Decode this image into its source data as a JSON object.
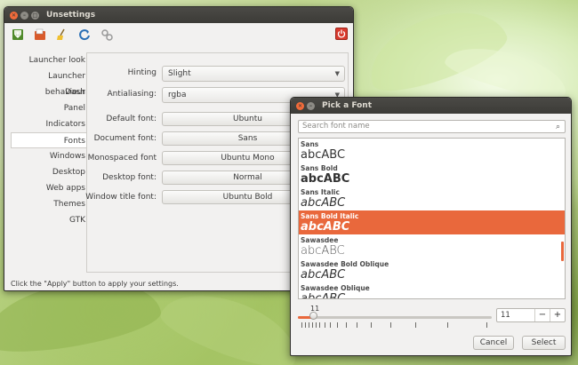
{
  "main_window": {
    "title": "Unsettings",
    "toolbar": {
      "icons": [
        "save-icon",
        "open-icon",
        "clean-icon",
        "refresh-icon",
        "settings-icon"
      ],
      "power_icon": "power-icon"
    },
    "sidebar": {
      "items": [
        {
          "label": "Launcher look"
        },
        {
          "label": "Launcher behaviour"
        },
        {
          "label": "Dash"
        },
        {
          "label": "Panel"
        },
        {
          "label": "Indicators"
        },
        {
          "label": "Fonts",
          "selected": true
        },
        {
          "label": "Windows"
        },
        {
          "label": "Desktop"
        },
        {
          "label": "Web apps"
        },
        {
          "label": "Themes"
        },
        {
          "label": "GTK"
        }
      ]
    },
    "fonts_panel": {
      "hinting": {
        "label": "Hinting",
        "value": "Slight"
      },
      "antialiasing": {
        "label": "Antialiasing:",
        "value": "rgba"
      },
      "default_font": {
        "label": "Default font:",
        "value": "Ubuntu"
      },
      "document_font": {
        "label": "Document font:",
        "value": "Sans"
      },
      "monospaced_font": {
        "label": "Monospaced font",
        "value": "Ubuntu Mono"
      },
      "desktop_font": {
        "label": "Desktop font:",
        "value": "Normal"
      },
      "window_title_font": {
        "label": "Window title font:",
        "value": "Ubuntu Bold"
      }
    },
    "status": "Click the \"Apply\" button to apply your settings."
  },
  "font_dialog": {
    "title": "Pick a Font",
    "search_placeholder": "Search font name",
    "fonts": [
      {
        "name": "Sans",
        "preview": "abcABC",
        "style": "normal",
        "weight": "normal"
      },
      {
        "name": "Sans Bold",
        "preview": "abcABC",
        "style": "normal",
        "weight": "bold"
      },
      {
        "name": "Sans Italic",
        "preview": "abcABC",
        "style": "italic",
        "weight": "normal"
      },
      {
        "name": "Sans Bold Italic",
        "preview": "abcABC",
        "style": "italic",
        "weight": "bold",
        "selected": true
      },
      {
        "name": "Sawasdee",
        "preview": "abcABC",
        "style": "normal",
        "weight": "normal"
      },
      {
        "name": "Sawasdee Bold Oblique",
        "preview": "abcABC",
        "style": "italic",
        "weight": "normal"
      },
      {
        "name": "Sawasdee Oblique",
        "preview": "abcABC",
        "style": "italic",
        "weight": "normal"
      }
    ],
    "size_slider_value": "11",
    "size_input": "11",
    "minus_label": "−",
    "plus_label": "+",
    "cancel_label": "Cancel",
    "select_label": "Select"
  },
  "colors": {
    "accent": "#e9683c",
    "titlebar": "#3c3b37",
    "window_bg": "#f2f1f0"
  }
}
